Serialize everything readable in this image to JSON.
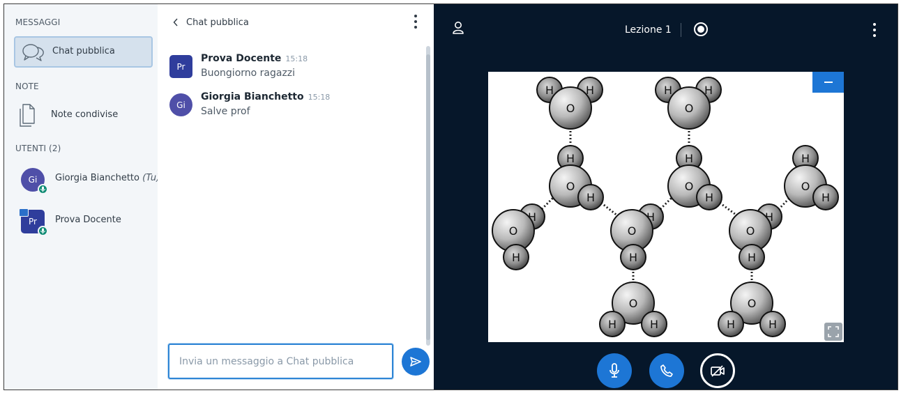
{
  "sidebar": {
    "messages_title": "MESSAGGI",
    "public_chat_label": "Chat pubblica",
    "notes_title": "NOTE",
    "shared_notes_label": "Note condivise",
    "users_title": "UTENTI (2)",
    "users": [
      {
        "initials": "Gi",
        "name": "Giorgia Bianchetto",
        "suffix": "(Tu)",
        "avatar_color": "#4f4fa8",
        "role": "viewer"
      },
      {
        "initials": "Pr",
        "name": "Prova Docente",
        "suffix": "",
        "avatar_color": "#2f3d9c",
        "role": "presenter"
      }
    ]
  },
  "chat": {
    "back_icon": "chevron-left-icon",
    "title": "Chat pubblica",
    "messages": [
      {
        "initials": "Pr",
        "author": "Prova Docente",
        "time": "15:18",
        "text": "Buongiorno ragazzi",
        "avatar_color": "#2f3d9c"
      },
      {
        "initials": "Gi",
        "author": "Giorgia Bianchetto",
        "time": "15:18",
        "text": "Salve prof",
        "avatar_color": "#4f4fa8"
      }
    ],
    "input_placeholder": "Invia un messaggio a Chat pubblica",
    "input_value": ""
  },
  "presentation": {
    "title": "Lezione 1",
    "icons": {
      "user": "user-icon",
      "record": "record-icon",
      "menu": "more-vertical-icon",
      "minimize": "minimize-icon",
      "fullscreen": "fullscreen-icon"
    },
    "slide_atoms": {
      "oxygen": "O",
      "hydrogen": "H"
    }
  },
  "controls": {
    "mic_icon": "microphone-icon",
    "phone_icon": "phone-icon",
    "camera_icon": "camera-off-icon"
  },
  "colors": {
    "accent": "#1d76d5",
    "stage_bg": "#06172a",
    "sidebar_bg": "#f3f6f9",
    "voice_badge": "#0b8a73"
  }
}
